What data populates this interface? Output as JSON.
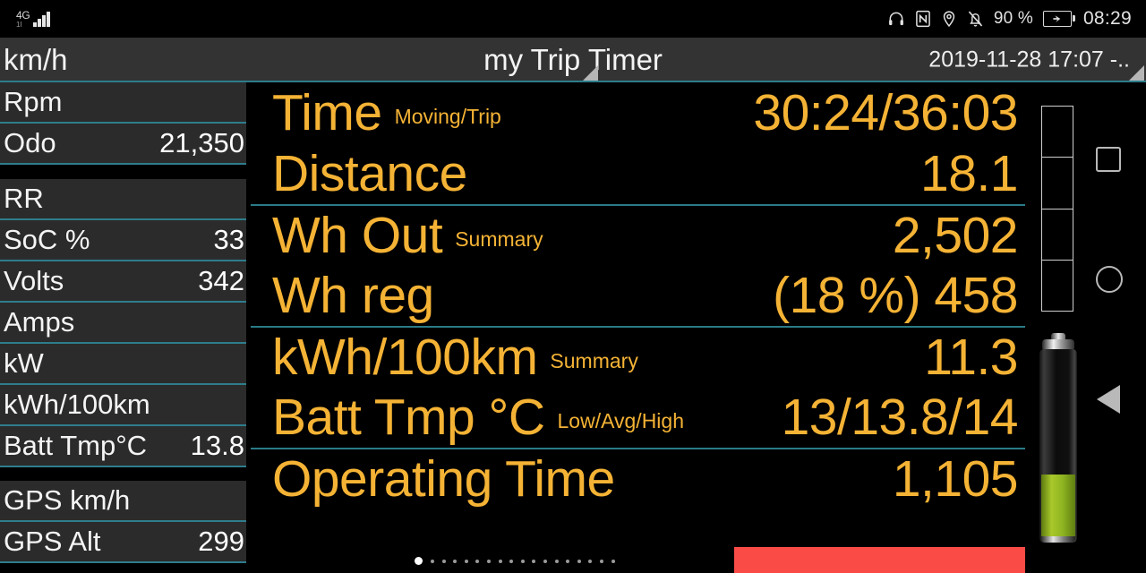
{
  "statusbar": {
    "network_label": "4G",
    "network_sub": "1I",
    "icons": [
      "headphones-icon",
      "nfc-icon",
      "location-icon",
      "mute-icon"
    ],
    "battery_percent": "90 %",
    "clock": "08:29"
  },
  "titlebar": {
    "unit": "km/h",
    "title": "my Trip Timer",
    "date": "2019-11-28 17:07 -.."
  },
  "sidebar": {
    "groups": [
      {
        "rows": [
          {
            "label": "Rpm",
            "value": ""
          },
          {
            "label": "Odo",
            "value": "21,350"
          }
        ]
      },
      {
        "rows": [
          {
            "label": "RR",
            "value": ""
          },
          {
            "label": "SoC %",
            "value": "33"
          },
          {
            "label": "Volts",
            "value": "342"
          },
          {
            "label": "Amps",
            "value": ""
          },
          {
            "label": "kW",
            "value": ""
          },
          {
            "label": "kWh/100km",
            "value": ""
          },
          {
            "label": "Batt Tmp°C",
            "value": "13.8"
          }
        ]
      },
      {
        "rows": [
          {
            "label": "GPS km/h",
            "value": ""
          },
          {
            "label": "GPS Alt",
            "value": "299"
          }
        ]
      }
    ]
  },
  "main": {
    "rows": [
      {
        "label": "Time",
        "sub": "Moving/Trip",
        "value": "30:24/36:03",
        "separator": false
      },
      {
        "label": "Distance",
        "sub": "",
        "value": "18.1",
        "separator": false
      },
      {
        "label": "Wh Out",
        "sub": "Summary",
        "value": "2,502",
        "separator": true
      },
      {
        "label": "Wh reg",
        "sub": "",
        "value": "(18 %) 458",
        "separator": false
      },
      {
        "label": "kWh/100km",
        "sub": "Summary",
        "value": "11.3",
        "separator": true
      },
      {
        "label": "Batt Tmp °C",
        "sub": "Low/Avg/High",
        "value": "13/13.8/14",
        "separator": false
      },
      {
        "label": "Operating Time",
        "sub": "",
        "value": "1,105",
        "separator": true
      }
    ],
    "page_dots_total": 18,
    "page_dots_active_index": 0
  },
  "right_panel": {
    "segment_gauge_segments": 4,
    "battery_fill_percent": 33
  },
  "navbar": {
    "recents_label": "square-button",
    "home_label": "circle-button",
    "back_label": "triangle-button"
  },
  "colors": {
    "accent_amber": "#f5b335",
    "separator_teal": "#2e7d8c",
    "battery_green": "#a8c82a",
    "alert_red": "#fa4b47",
    "sidebar_row_bg": "#2b2b2b",
    "titlebar_bg": "#333333"
  }
}
